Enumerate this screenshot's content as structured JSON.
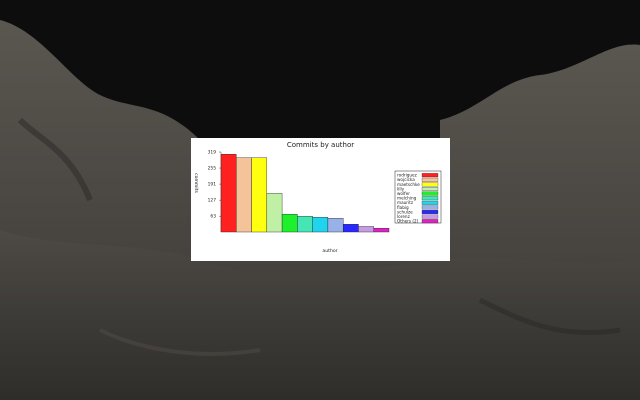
{
  "scene": {
    "name": "3D terrain background",
    "sky_color": "#0c0c0c",
    "ground_color": "#3e3b36"
  },
  "chart_data": {
    "type": "bar",
    "title": "Commits by author",
    "xlabel": "author",
    "ylabel": "commits",
    "yticks": [
      "63",
      "127",
      "191",
      "255",
      "319"
    ],
    "ylim": [
      0,
      319
    ],
    "categories": [
      "rodriguez",
      "wojcicka",
      "maetschke",
      "lilly",
      "wolfer",
      "melching",
      "mauritz",
      "flabig",
      "schulze",
      "lorenz",
      "Others (2)"
    ],
    "values": [
      310,
      296,
      296,
      154,
      71,
      63,
      59,
      55,
      31,
      22,
      15
    ],
    "colors": [
      "#ff2020",
      "#f5c39a",
      "#ffff10",
      "#bff0a6",
      "#1ff02c",
      "#46e6b4",
      "#20d4ee",
      "#98b2e8",
      "#2828ff",
      "#c89ae6",
      "#e020c2"
    ],
    "legend_position": "right",
    "grid": false
  }
}
